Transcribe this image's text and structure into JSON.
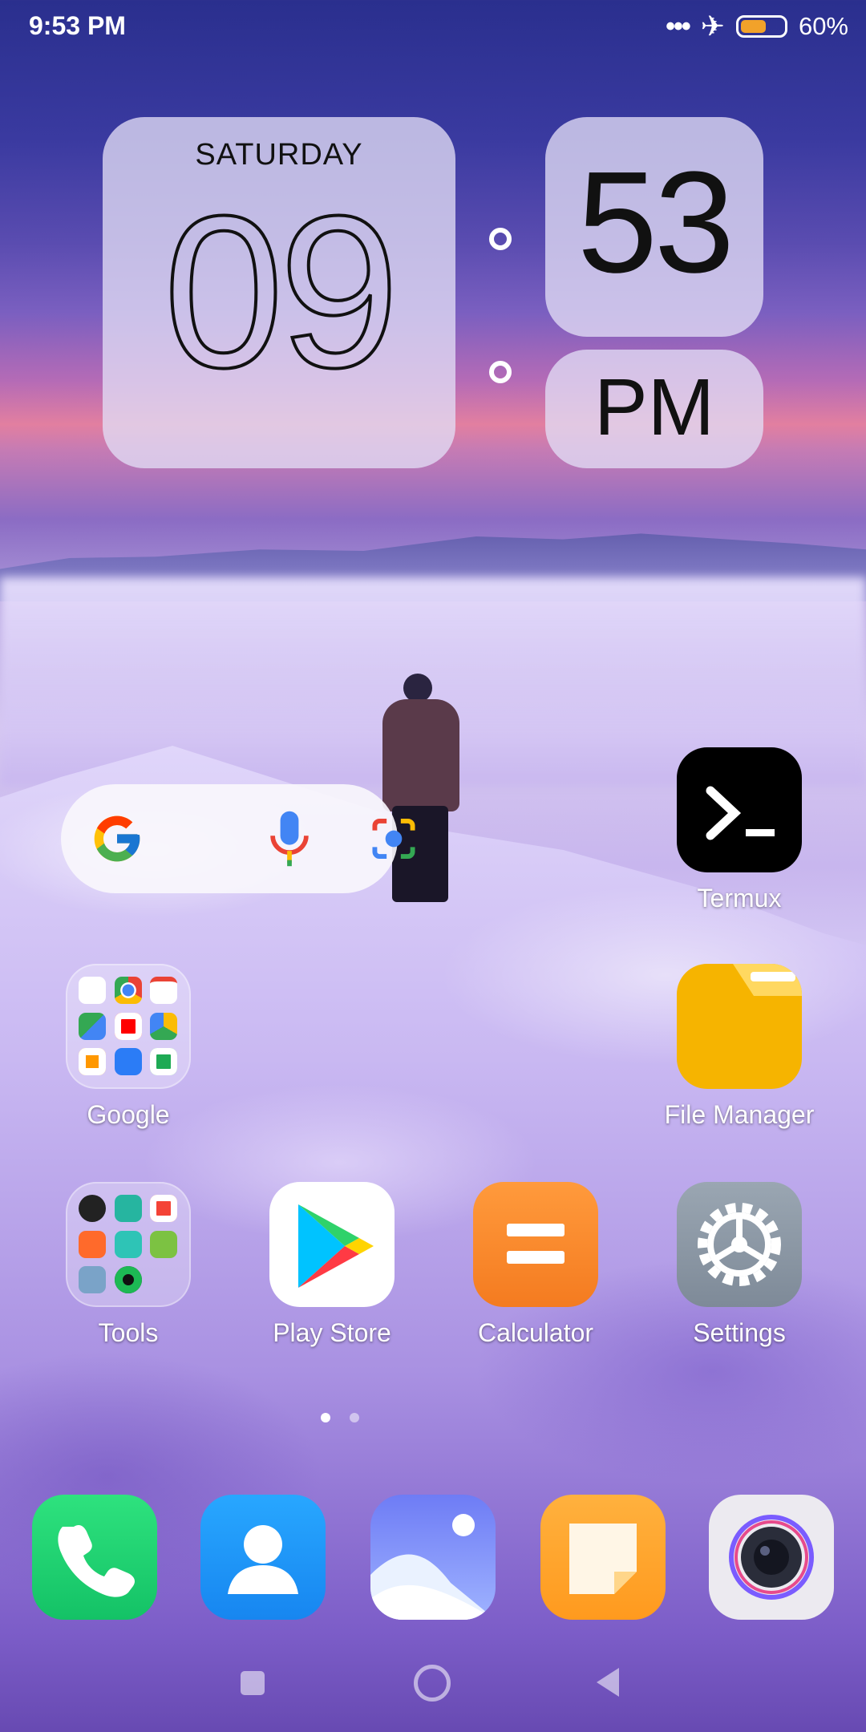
{
  "status_bar": {
    "time": "9:53 PM",
    "more_dots": "•••",
    "airplane_icon": "✈",
    "battery_percent_text": "60%",
    "battery_level": 0.6,
    "battery_color": "#f2a22a"
  },
  "clock_widget": {
    "day_name": "SATURDAY",
    "hour": "09",
    "minute": "53",
    "ampm": "PM"
  },
  "search_bar": {
    "icons": [
      "google-g-icon",
      "mic-icon",
      "lens-camera-icon"
    ]
  },
  "apps": {
    "termux": {
      "label": "Termux",
      "glyph": "❯_"
    },
    "google_folder": {
      "label": "Google"
    },
    "file_manager": {
      "label": "File Manager"
    },
    "tools_folder": {
      "label": "Tools"
    },
    "play_store": {
      "label": "Play Store"
    },
    "calculator": {
      "label": "Calculator"
    },
    "settings": {
      "label": "Settings"
    }
  },
  "page_indicator": {
    "pages": 2,
    "current": 1
  },
  "dock": {
    "icons": [
      "phone-icon",
      "contacts-icon",
      "gallery-icon",
      "notes-icon",
      "camera-icon"
    ]
  }
}
